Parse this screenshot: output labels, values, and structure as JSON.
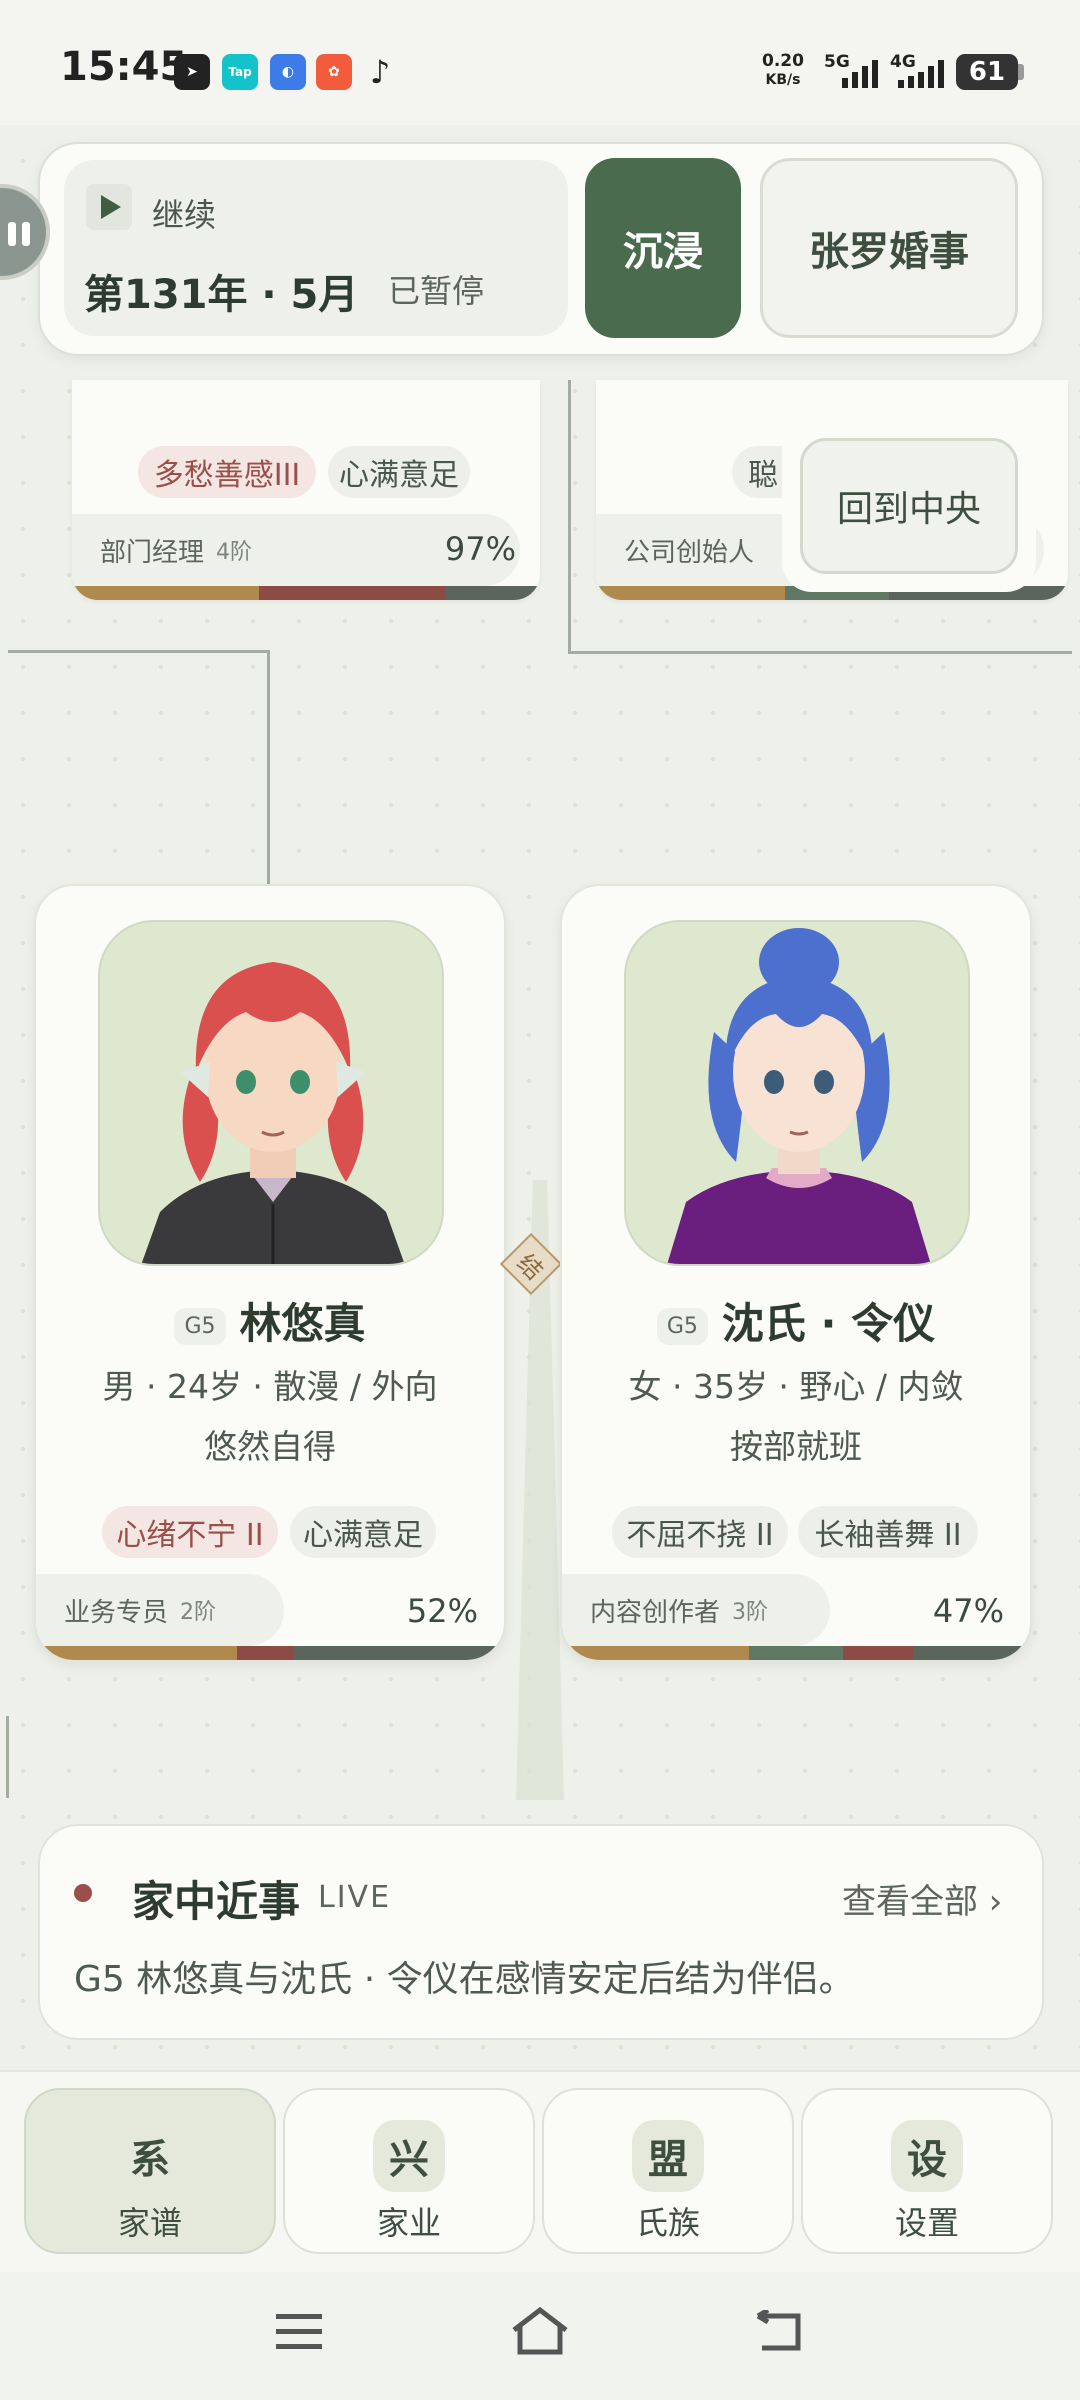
{
  "status_bar": {
    "time": "15:45",
    "net_speed_value": "0.20",
    "net_speed_unit": "KB/s",
    "sim1": "5G",
    "sim2": "4G",
    "battery": "61",
    "apps": [
      "telegram-icon",
      "taptap-icon",
      "browser-icon",
      "shop-icon",
      "tiktok-icon"
    ]
  },
  "controls": {
    "continue_label": "继续",
    "date": "第131年 · 5月",
    "state": "已暂停",
    "immerse_label": "沉浸",
    "event_label": "张罗婚事",
    "recenter_label": "回到中央"
  },
  "upper_cards": [
    {
      "tags": [
        {
          "text": "多愁善感III",
          "tone": "red"
        },
        {
          "text": "心满意足",
          "tone": "green"
        }
      ],
      "role": "部门经理",
      "rank": "4阶",
      "percent": "97%"
    },
    {
      "tags": [
        {
          "text": "聪",
          "tone": "green"
        }
      ],
      "role": "公司创始人"
    }
  ],
  "persons": [
    {
      "grade": "G5",
      "name": "林悠真",
      "info": "男 · 24岁 · 散漫 / 外向",
      "trait": "悠然自得",
      "tags": [
        {
          "text": "心绪不宁 II",
          "tone": "red"
        },
        {
          "text": "心满意足",
          "tone": "green"
        }
      ],
      "role": "业务专员",
      "rank": "2阶",
      "percent": "52%",
      "hair_color": "#d9504f",
      "clothes_color": "#3a3a3c"
    },
    {
      "grade": "G5",
      "name": "沈氏 · 令仪",
      "info": "女 · 35岁 · 野心 / 内敛",
      "trait": "按部就班",
      "tags": [
        {
          "text": "不屈不挠 II",
          "tone": "green"
        },
        {
          "text": "长袖善舞 II",
          "tone": "green"
        }
      ],
      "role": "内容创作者",
      "rank": "3阶",
      "percent": "47%",
      "hair_color": "#4d6fce",
      "clothes_color": "#6a1f7e"
    }
  ],
  "marriage_knot": "结",
  "news": {
    "title": "家中近事",
    "live": "LIVE",
    "view_all": "查看全部 ›",
    "text": "G5 林悠真与沈氏 · 令仪在感情安定后结为伴侣。"
  },
  "nav": [
    {
      "icon": "系",
      "label": "家谱",
      "active": true
    },
    {
      "icon": "兴",
      "label": "家业",
      "active": false
    },
    {
      "icon": "盟",
      "label": "氏族",
      "active": false
    },
    {
      "icon": "设",
      "label": "设置",
      "active": false
    }
  ],
  "colors": {
    "accent": "#4a6b4d",
    "background": "#eef1ea",
    "card": "#fbfbf7",
    "red_tag": "#9a4f4a"
  }
}
